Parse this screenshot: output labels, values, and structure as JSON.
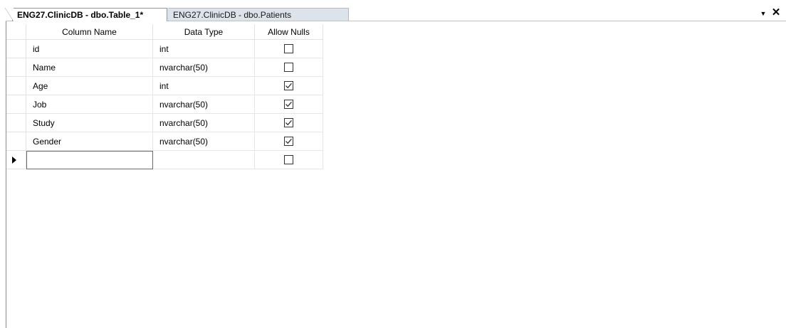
{
  "tabs": [
    {
      "label": "ENG27.ClinicDB - dbo.Table_1*",
      "active": true
    },
    {
      "label": "ENG27.ClinicDB - dbo.Patients",
      "active": false
    }
  ],
  "tab_controls": {
    "dropdown_icon": "chevron-down-icon",
    "close_icon": "close-icon"
  },
  "grid": {
    "columns": [
      "Column Name",
      "Data Type",
      "Allow Nulls"
    ],
    "rows": [
      {
        "name": "id",
        "type": "int",
        "allow_nulls": false
      },
      {
        "name": "Name",
        "type": "nvarchar(50)",
        "allow_nulls": false
      },
      {
        "name": "Age",
        "type": "int",
        "allow_nulls": true
      },
      {
        "name": "Job",
        "type": "nvarchar(50)",
        "allow_nulls": true
      },
      {
        "name": "Study",
        "type": "nvarchar(50)",
        "allow_nulls": true
      },
      {
        "name": "Gender",
        "type": "nvarchar(50)",
        "allow_nulls": true
      },
      {
        "name": "",
        "type": "",
        "allow_nulls": false,
        "new_row": true
      }
    ]
  },
  "colors": {
    "tab_border": "#8b98a8",
    "inactive_tab_bg": "#dde3ea",
    "grid_line": "#e6e6e6"
  }
}
